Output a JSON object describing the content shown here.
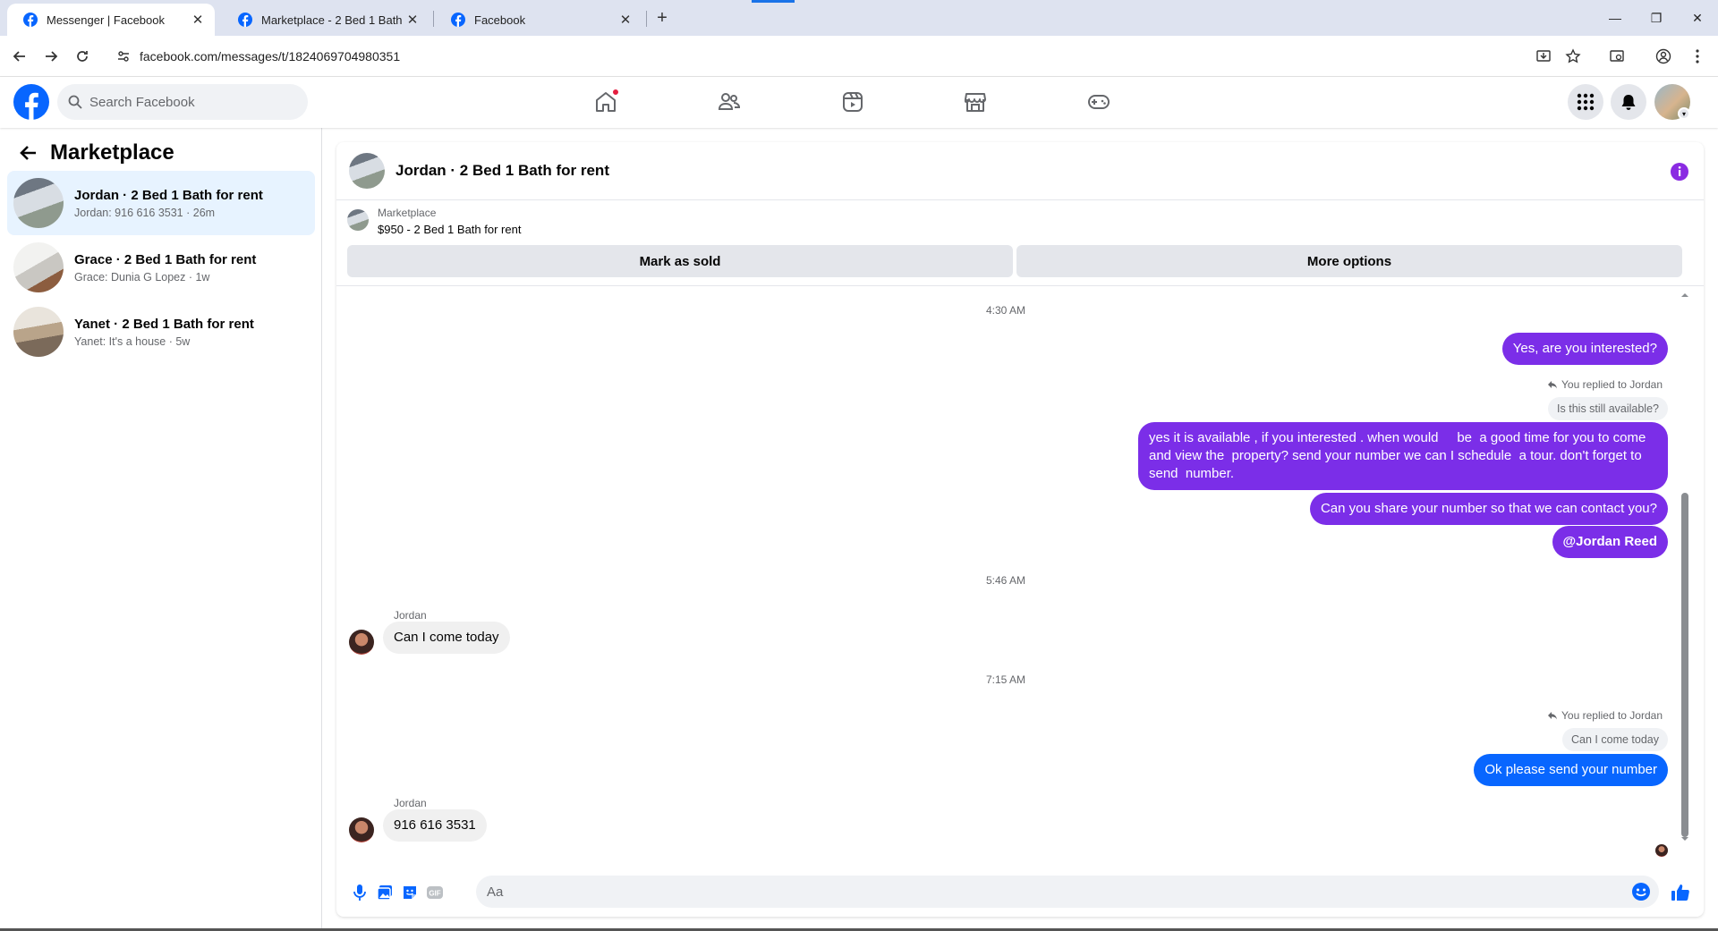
{
  "browser": {
    "tabs": [
      {
        "title": "Messenger | Facebook",
        "active": true
      },
      {
        "title": "Marketplace - 2 Bed 1 Bath for",
        "active": false
      },
      {
        "title": "Facebook",
        "active": false
      }
    ],
    "url": "facebook.com/messages/t/1824069704980351"
  },
  "header": {
    "search_placeholder": "Search Facebook",
    "nav": [
      "home-icon",
      "friends-icon",
      "video-icon",
      "marketplace-icon",
      "gaming-icon"
    ],
    "brand_color": "#0866ff"
  },
  "sidebar": {
    "title": "Marketplace",
    "conversations": [
      {
        "title": "Jordan · 2 Bed 1 Bath for rent",
        "preview": "Jordan: 916 616 3531 · 26m",
        "active": true
      },
      {
        "title": "Grace · 2 Bed 1 Bath for rent",
        "preview": "Grace: Dunia G Lopez · 1w",
        "active": false
      },
      {
        "title": "Yanet · 2 Bed 1 Bath for rent",
        "preview": "Yanet: It's a house · 5w",
        "active": false
      }
    ]
  },
  "chat": {
    "title": "Jordan · 2 Bed 1 Bath for rent",
    "listing": {
      "source": "Marketplace",
      "name": "$950 - 2 Bed 1 Bath for rent"
    },
    "actions": {
      "mark_sold": "Mark as sold",
      "more": "More options"
    },
    "times": [
      "4:30 AM",
      "5:46 AM",
      "7:15 AM"
    ],
    "outgoing_1": "Yes, are you interested?",
    "reply_note": "You replied to Jordan",
    "quoted_1": "Is this still available?",
    "outgoing_2": "yes it is available , if you interested . when would     be  a good time for you to come and view the  property? send your number we can I schedule  a tour. don't forget to send  number.",
    "outgoing_3": "Can you share your number so that we can contact you?",
    "outgoing_4": "@Jordan Reed",
    "sender_name": "Jordan",
    "incoming_1": "Can I come today",
    "quoted_2": "Can I come today",
    "outgoing_5": "Ok please send your number",
    "incoming_2": "916 616 3531",
    "composer_placeholder": "Aa",
    "colors": {
      "outgoing": "#7b2ee8",
      "outgoing_last": "#0866ff",
      "incoming": "#f0f0f0",
      "accent": "#8a2be2"
    }
  }
}
